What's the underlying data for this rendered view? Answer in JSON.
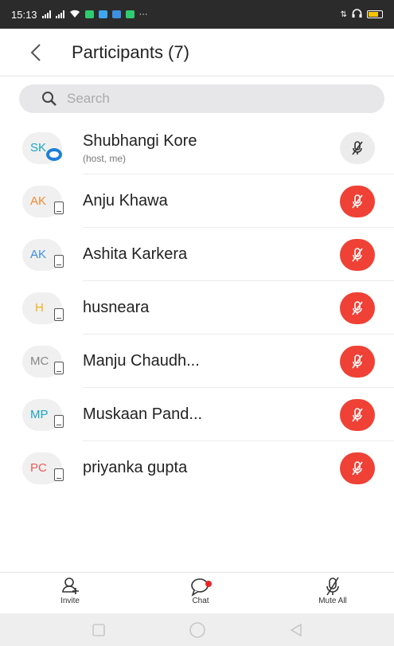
{
  "status": {
    "time": "15:13",
    "overflow": "···"
  },
  "header": {
    "title": "Participants (7)"
  },
  "search": {
    "placeholder": "Search"
  },
  "participants": [
    {
      "initials": "SK",
      "color": "#1aa6c6",
      "name": "Shubhangi Kore",
      "sub": "(host, me)",
      "device": "zoom"
    },
    {
      "initials": "AK",
      "color": "#f28b35",
      "name": "Anju Khawa",
      "device": "phone"
    },
    {
      "initials": "AK",
      "color": "#3e8fe0",
      "name": "Ashita Karkera",
      "device": "phone"
    },
    {
      "initials": "H",
      "color": "#f2b21b",
      "name": "husneara",
      "device": "phone"
    },
    {
      "initials": "MC",
      "color": "#888888",
      "name": "Manju Chaudh...",
      "device": "phone"
    },
    {
      "initials": "MP",
      "color": "#1aa6c6",
      "name": "Muskaan Pand...",
      "device": "phone"
    },
    {
      "initials": "PC",
      "color": "#ef5a5a",
      "name": "priyanka gupta",
      "device": "phone"
    }
  ],
  "toolbar": {
    "invite": "Invite",
    "chat": "Chat",
    "mute_all": "Mute All"
  },
  "colors": {
    "muted_red": "#ef4136",
    "chat_dot": "#e8252a"
  }
}
